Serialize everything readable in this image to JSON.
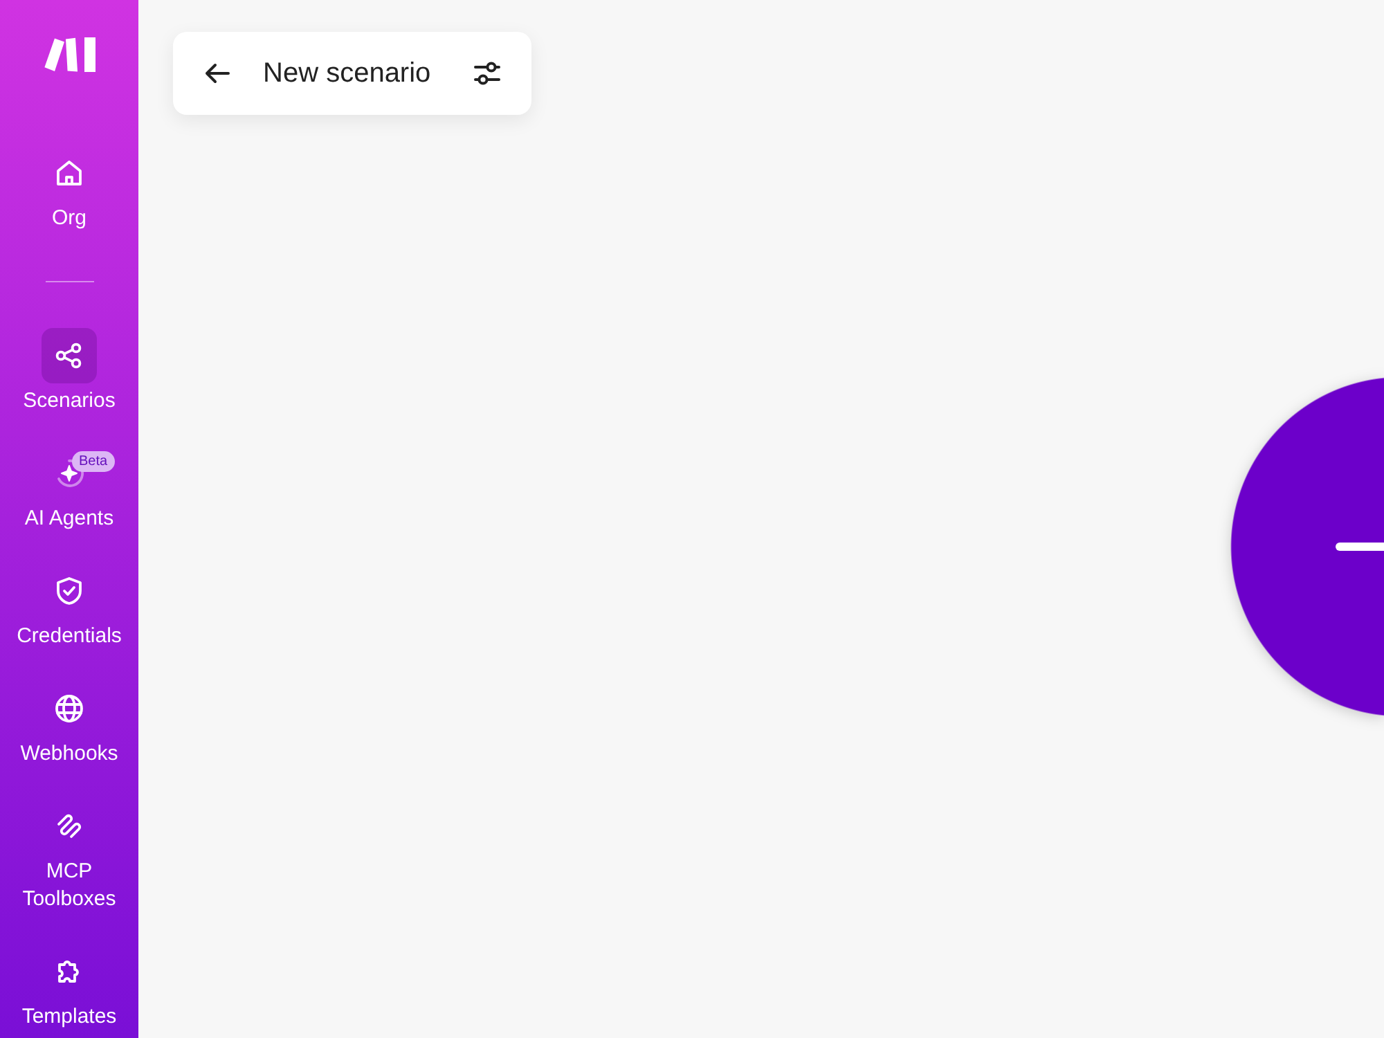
{
  "sidebar": {
    "groups": [
      {
        "items": [
          {
            "label": "Org",
            "selected": false
          }
        ]
      },
      {
        "items": [
          {
            "label": "Scenarios",
            "selected": true
          },
          {
            "label": "AI Agents",
            "selected": false,
            "badge": "Beta"
          },
          {
            "label": "Credentials",
            "selected": false
          },
          {
            "label": "Webhooks",
            "selected": false
          },
          {
            "label": "MCP Toolboxes",
            "selected": false
          },
          {
            "label": "Templates",
            "selected": false
          }
        ]
      }
    ]
  },
  "header": {
    "title": "New scenario"
  }
}
